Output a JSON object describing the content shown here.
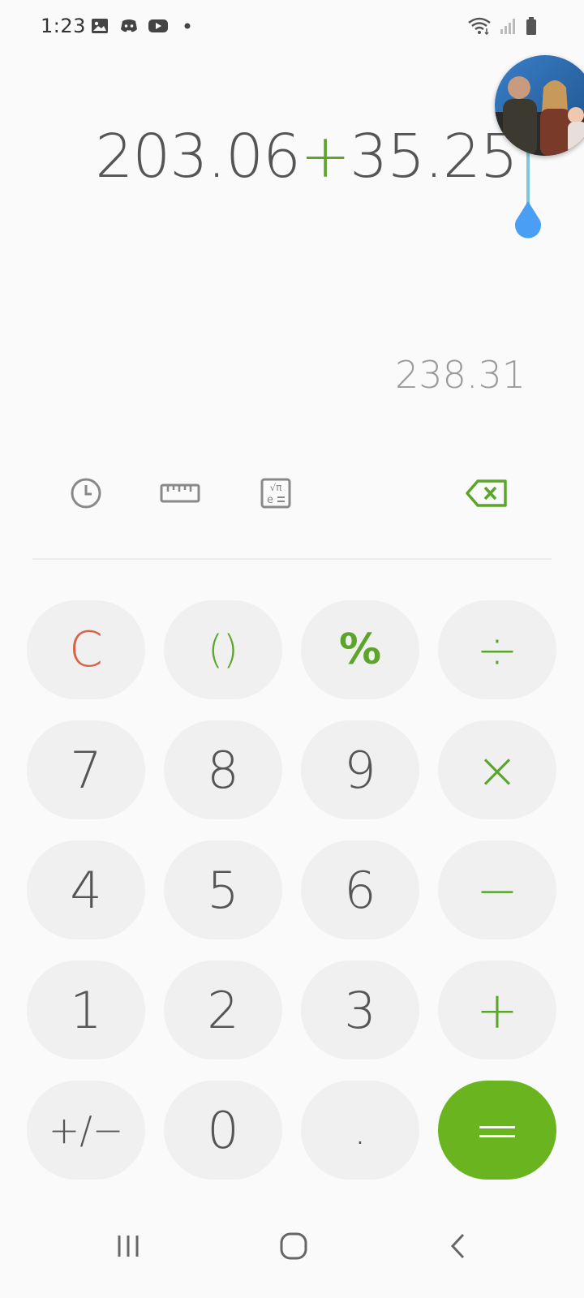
{
  "status_bar": {
    "time": "1:23",
    "left_icons": [
      "gallery-icon",
      "discord-icon",
      "youtube-icon",
      "dot-icon"
    ],
    "right_icons": [
      "wifi-icon",
      "signal-icon",
      "battery-icon"
    ]
  },
  "display": {
    "operand1": "203.06",
    "operator": "+",
    "operand2": "35.25",
    "result_preview": "238.31"
  },
  "tools": {
    "history": "clock-icon",
    "unit_converter": "ruler-icon",
    "scientific": "scientific-calculator-icon",
    "backspace": "backspace-icon"
  },
  "keypad": {
    "clear": "C",
    "parentheses": "()",
    "percent": "%",
    "divide": "÷",
    "seven": "7",
    "eight": "8",
    "nine": "9",
    "multiply": "×",
    "four": "4",
    "five": "5",
    "six": "6",
    "minus": "−",
    "one": "1",
    "two": "2",
    "three": "3",
    "plus": "+",
    "plus_minus": "+/−",
    "zero": "0",
    "decimal": ".",
    "equals": "="
  },
  "navigation": {
    "recents": "recents-icon",
    "home": "home-icon",
    "back": "back-icon"
  },
  "colors": {
    "accent_green": "#5aa52a",
    "equals_green": "#6ab51f",
    "clear_red": "#d9634a",
    "key_bg": "#f0f0f0",
    "background": "#fafafa"
  }
}
